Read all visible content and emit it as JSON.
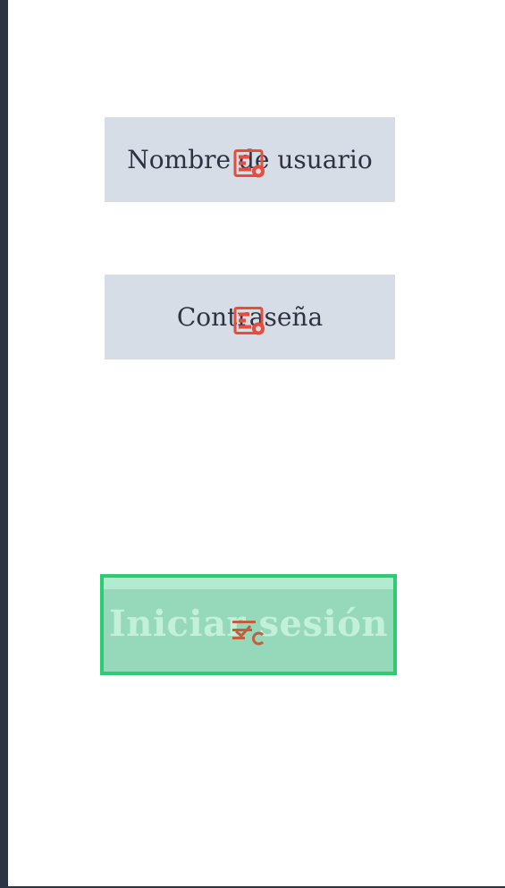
{
  "form": {
    "username_label": "Nombre de usuario",
    "password_label": "Contraseña",
    "login_label": "Iniciar sesión"
  },
  "colors": {
    "sidebar": "#2b3442",
    "field_background": "#d6dde6",
    "field_text": "#2b3442",
    "button_border": "#2ecc71",
    "button_fill": "#96d9ba",
    "button_text": "#c3f0d8",
    "icon_red": "#e74c3c"
  },
  "icons": {
    "field_icon": "text-field-icon",
    "button_icon": "button-component-icon"
  }
}
